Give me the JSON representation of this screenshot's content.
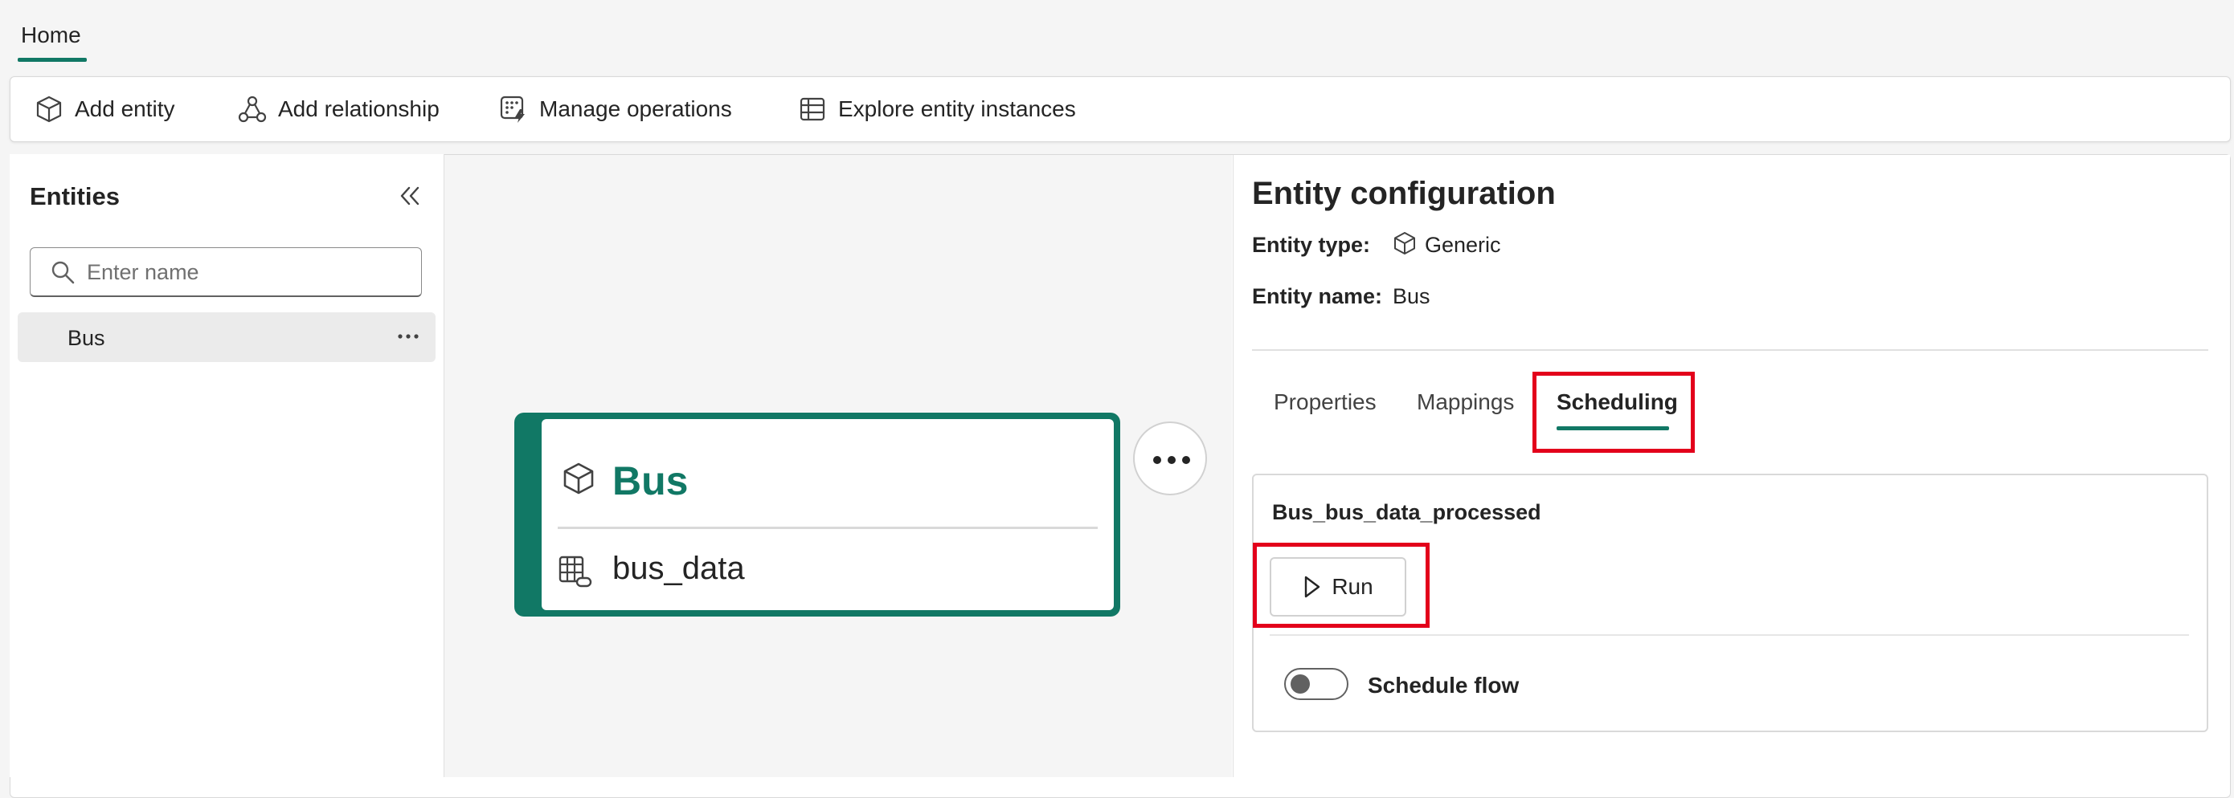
{
  "header": {
    "tab_home": "Home"
  },
  "toolbar": {
    "add_entity": "Add entity",
    "add_relationship": "Add relationship",
    "manage_operations": "Manage operations",
    "explore_instances": "Explore entity instances"
  },
  "sidebar": {
    "title": "Entities",
    "search_placeholder": "Enter name",
    "items": [
      {
        "label": "Bus"
      }
    ]
  },
  "canvas": {
    "node": {
      "title": "Bus",
      "source": "bus_data"
    }
  },
  "config": {
    "title": "Entity configuration",
    "type_label": "Entity type:",
    "type_value": "Generic",
    "name_label": "Entity name:",
    "name_value": "Bus",
    "tabs": [
      {
        "label": "Properties"
      },
      {
        "label": "Mappings"
      },
      {
        "label": "Scheduling"
      }
    ],
    "active_tab": "Scheduling",
    "schedule": {
      "flow_name": "Bus_bus_data_processed",
      "run_label": "Run",
      "toggle_label": "Schedule flow",
      "toggle_on": false
    }
  },
  "colors": {
    "accent": "#117865",
    "highlight": "#e3001b"
  }
}
